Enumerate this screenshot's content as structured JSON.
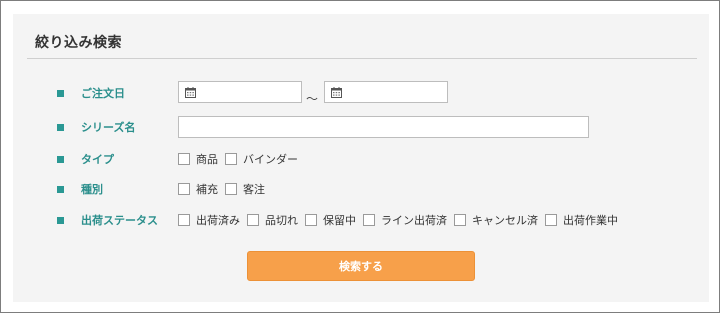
{
  "panel": {
    "title": "絞り込み検索"
  },
  "fields": {
    "order_date": {
      "label": "ご注文日",
      "separator": "〜",
      "from_value": "",
      "to_value": ""
    },
    "series_name": {
      "label": "シリーズ名",
      "value": ""
    },
    "type": {
      "label": "タイプ",
      "options": [
        "商品",
        "バインダー"
      ]
    },
    "kind": {
      "label": "種別",
      "options": [
        "補充",
        "客注"
      ]
    },
    "shipping_status": {
      "label": "出荷ステータス",
      "options": [
        "出荷済み",
        "品切れ",
        "保留中",
        "ライン出荷済",
        "キャンセル済",
        "出荷作業中"
      ]
    }
  },
  "actions": {
    "search_label": "検索する"
  },
  "colors": {
    "label_teal": "#2b8f8c",
    "bullet_teal": "#2a9894",
    "button_orange": "#f7a04a"
  },
  "icons": {
    "date_field": "calendar-icon",
    "bullet": "square-bullet"
  }
}
